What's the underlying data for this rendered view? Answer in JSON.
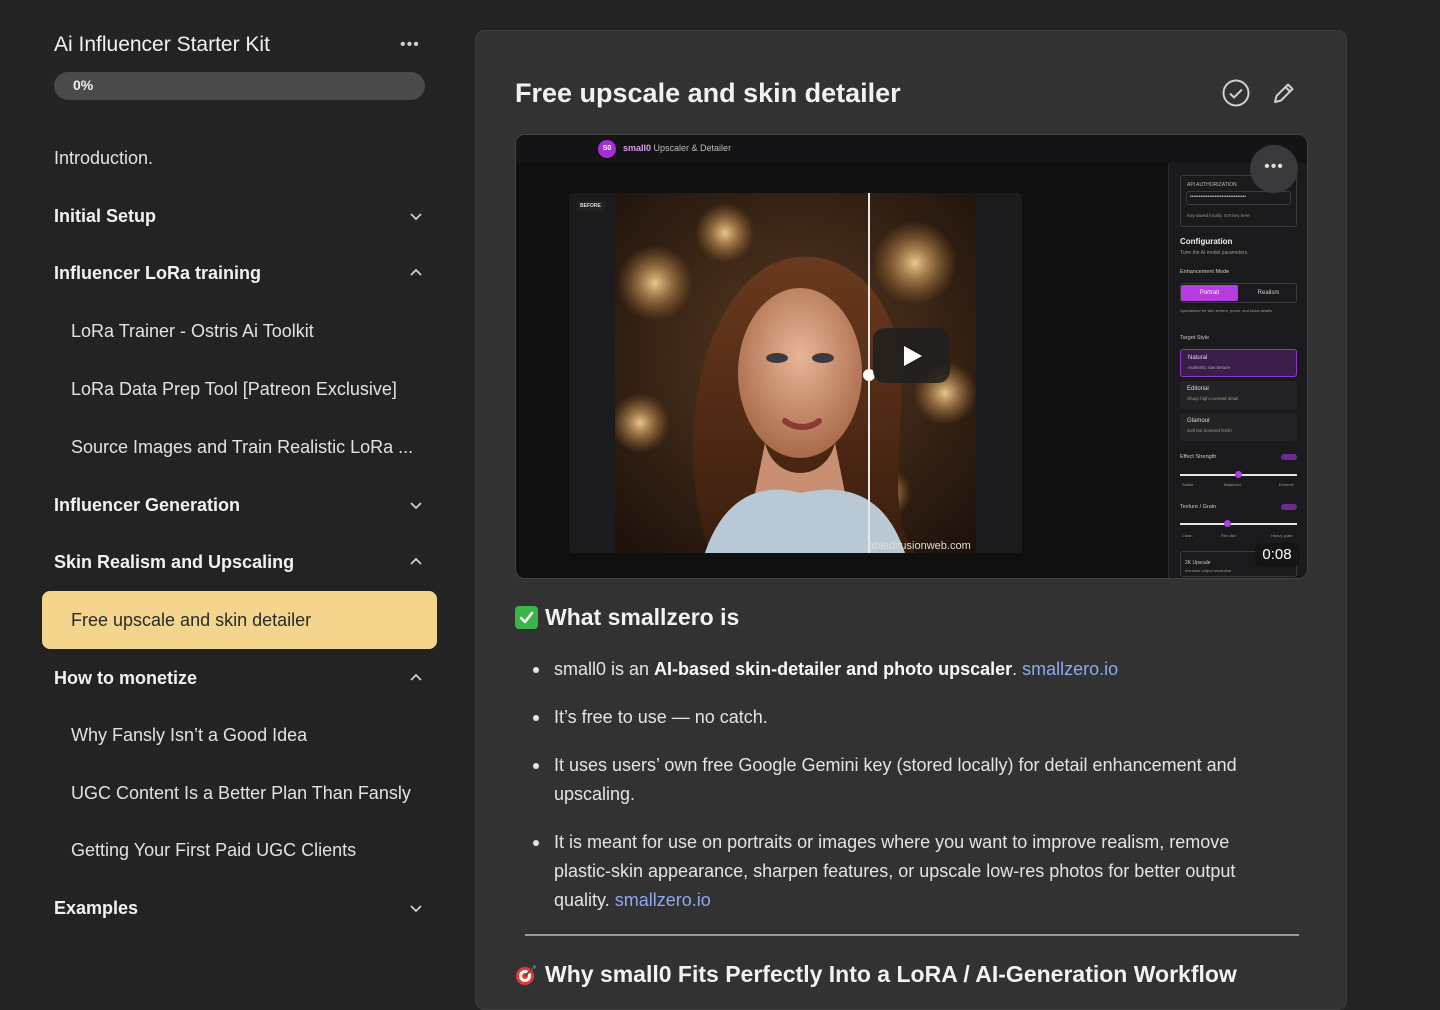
{
  "course": {
    "title": "Ai Influencer Starter Kit",
    "more_label": "•••",
    "progress_text": "0%",
    "progress_value": 0
  },
  "nav": {
    "intro": "Introduction.",
    "initial_setup": "Initial Setup",
    "lora_training": "Influencer LoRa training",
    "lora_trainer": "LoRa Trainer - Ostris Ai Toolkit",
    "lora_data_prep": "LoRa Data Prep Tool [Patreon Exclusive]",
    "source_images": "Source Images and Train Realistic LoRa ...",
    "influencer_generation": "Influencer Generation",
    "skin_realism": "Skin Realism and Upscaling",
    "free_upscale": "Free upscale and skin detailer",
    "monetize": "How to monetize",
    "why_fansly": "Why Fansly Isn’t a Good Idea",
    "ugc_better": "UGC Content Is a Better Plan Than Fansly",
    "first_ugc": "Getting Your First Paid UGC Clients",
    "examples": "Examples"
  },
  "lesson": {
    "title": "Free upscale and skin detailer",
    "video": {
      "logo_text": "S0",
      "app_brand": "small0",
      "app_title": " Upscaler & Detailer",
      "before_badge": "BEFORE",
      "watermark": "abledifusionweb.com",
      "more_label": "•••",
      "timestamp": "0:08",
      "panel": {
        "api_label": "API AUTHORIZATION",
        "key_mask": "••••••••••••••••••••••••••••••••",
        "key_note": "Key saved locally. Get key here",
        "config_title": "Configuration",
        "config_sub": "Tune the AI model parameters.",
        "mode_label": "Enhancement Mode",
        "mode_portrait": "Portrait",
        "mode_realism": "Realism",
        "mode_note": "Specialized for skin texture, pores, and facial details.",
        "style_label": "Target Style",
        "style_natural": "Natural",
        "style_natural_sub": "Authentic raw texture",
        "style_editorial": "Editorial",
        "style_editorial_sub": "Sharp high-contrast detail",
        "style_glamour": "Glamour",
        "style_glamour_sub": "Soft but textured finish",
        "effect_label": "Effect Strength",
        "effect_subtle": "Subtle",
        "effect_balanced": "Balanced",
        "effect_extreme": "Extreme",
        "texture_label": "Texture / Grain",
        "texture_clean": "Clean",
        "texture_film": "Film-like",
        "texture_heavy": "Heavy grain",
        "upscale_label": "2K Upscale",
        "upscale_sub": "Increase output resolution"
      }
    },
    "section1": {
      "heading": "What smallzero is",
      "b1_pre": "small0 is an ",
      "b1_bold": "AI-based skin-detailer and photo upscaler",
      "b1_post": ". ",
      "b1_link": "smallzero.io",
      "b2": "It’s free to use — no catch.",
      "b3": "It uses users’ own free Google Gemini key (stored locally) for detail enhancement and upscaling.",
      "b4_text": "It is meant for use on portraits or images where you want to improve realism, remove plastic-skin appearance, sharpen features, or upscale low-res photos for better output quality. ",
      "b4_link": "smallzero.io"
    },
    "section2": {
      "heading": "Why small0 Fits Perfectly Into a LoRA / AI-Generation Workflow"
    }
  },
  "colors": {
    "active_item": "#f3d58e",
    "link": "#8fa8f0",
    "accent_purple": "#b63be0",
    "check_green": "#39b54a"
  }
}
